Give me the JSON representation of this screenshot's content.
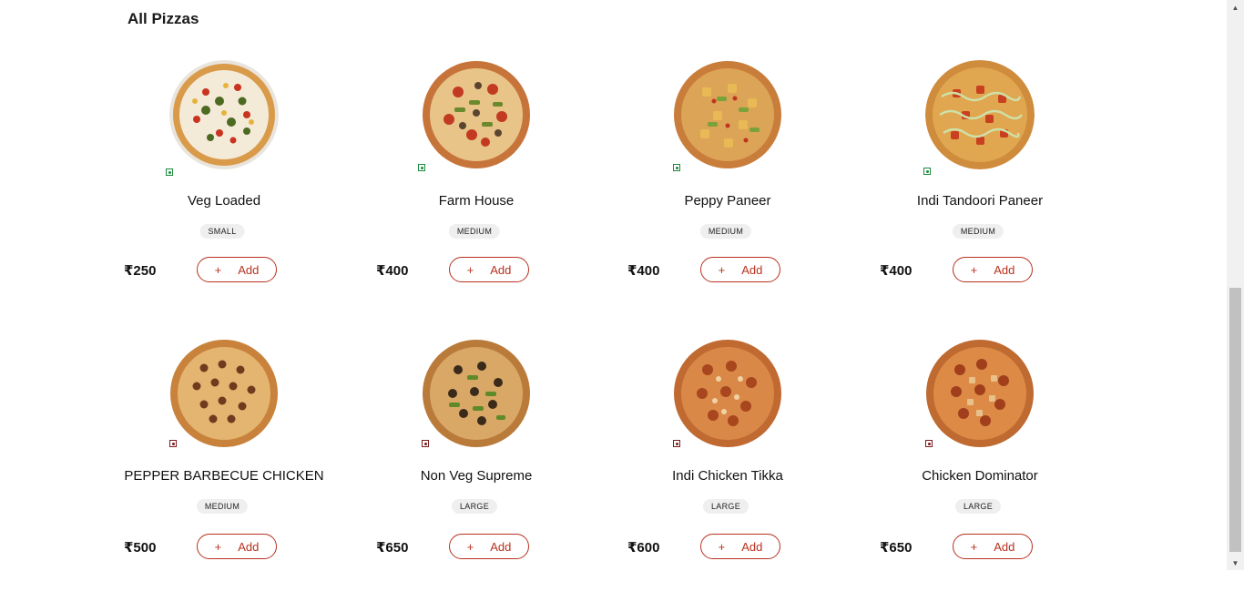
{
  "section_title": "All Pizzas",
  "currency_symbol": "₹",
  "add_label": "Add",
  "add_icon": "+",
  "colors": {
    "accent": "#b8321f",
    "veg": "#1a8a3a",
    "nonveg": "#7a1c1c",
    "badge_bg": "#efefef"
  },
  "pizzas": [
    {
      "name": "Veg Loaded",
      "size": "SMALL",
      "price": "₹250",
      "type": "veg",
      "icon": "pizza-image"
    },
    {
      "name": "Farm House",
      "size": "MEDIUM",
      "price": "₹400",
      "type": "veg",
      "icon": "pizza-image"
    },
    {
      "name": "Peppy Paneer",
      "size": "MEDIUM",
      "price": "₹400",
      "type": "veg",
      "icon": "pizza-image"
    },
    {
      "name": "Indi Tandoori Paneer",
      "size": "MEDIUM",
      "price": "₹400",
      "type": "veg",
      "icon": "pizza-image"
    },
    {
      "name": "PEPPER BARBECUE CHICKEN",
      "size": "MEDIUM",
      "price": "₹500",
      "type": "nonveg",
      "icon": "pizza-image"
    },
    {
      "name": "Non Veg Supreme",
      "size": "LARGE",
      "price": "₹650",
      "type": "nonveg",
      "icon": "pizza-image"
    },
    {
      "name": "Indi Chicken Tikka",
      "size": "LARGE",
      "price": "₹600",
      "type": "nonveg",
      "icon": "pizza-image"
    },
    {
      "name": "Chicken Dominator",
      "size": "LARGE",
      "price": "₹650",
      "type": "nonveg",
      "icon": "pizza-image"
    }
  ],
  "scrollbar": {
    "up_icon": "▲",
    "down_icon": "▼"
  }
}
